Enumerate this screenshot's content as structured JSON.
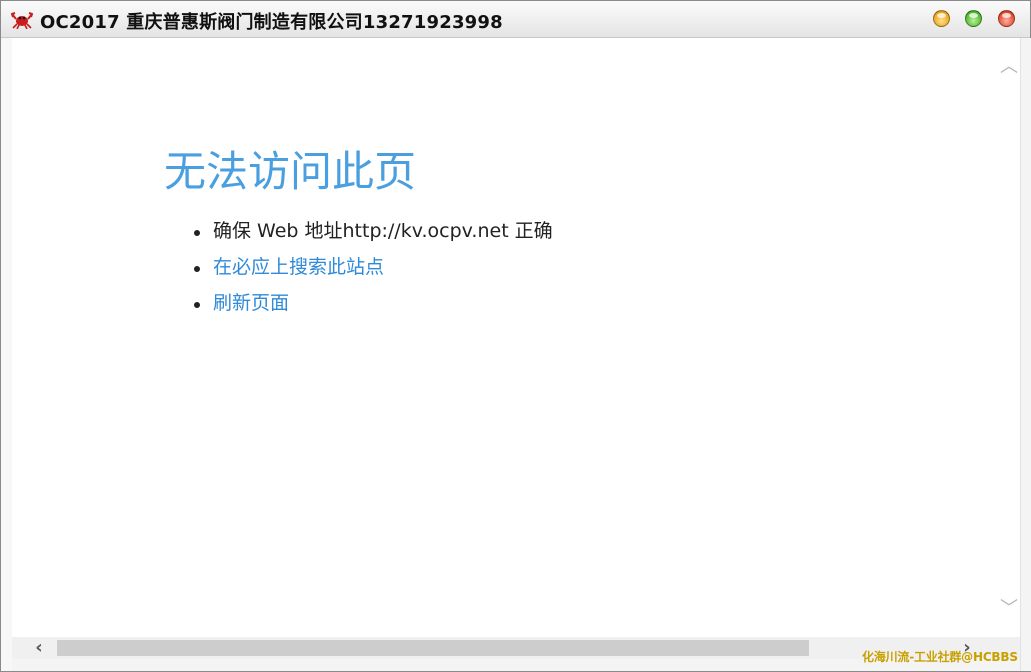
{
  "window": {
    "title": "OC2017  重庆普惠斯阀门制造有限公司13271923998",
    "icon": "crab-icon"
  },
  "error_page": {
    "title": "无法访问此页",
    "bullets": [
      {
        "text": "确保 Web 地址http://kv.ocpv.net 正确",
        "link": false
      },
      {
        "text": "在必应上搜索此站点",
        "link": true
      },
      {
        "text": "刷新页面",
        "link": true
      }
    ]
  },
  "watermark": "化海川流-工业社群@HCBBS",
  "colors": {
    "title_blue": "#4a9fe0",
    "link_blue": "#2f8ad8",
    "watermark_gold": "#c8a000"
  }
}
